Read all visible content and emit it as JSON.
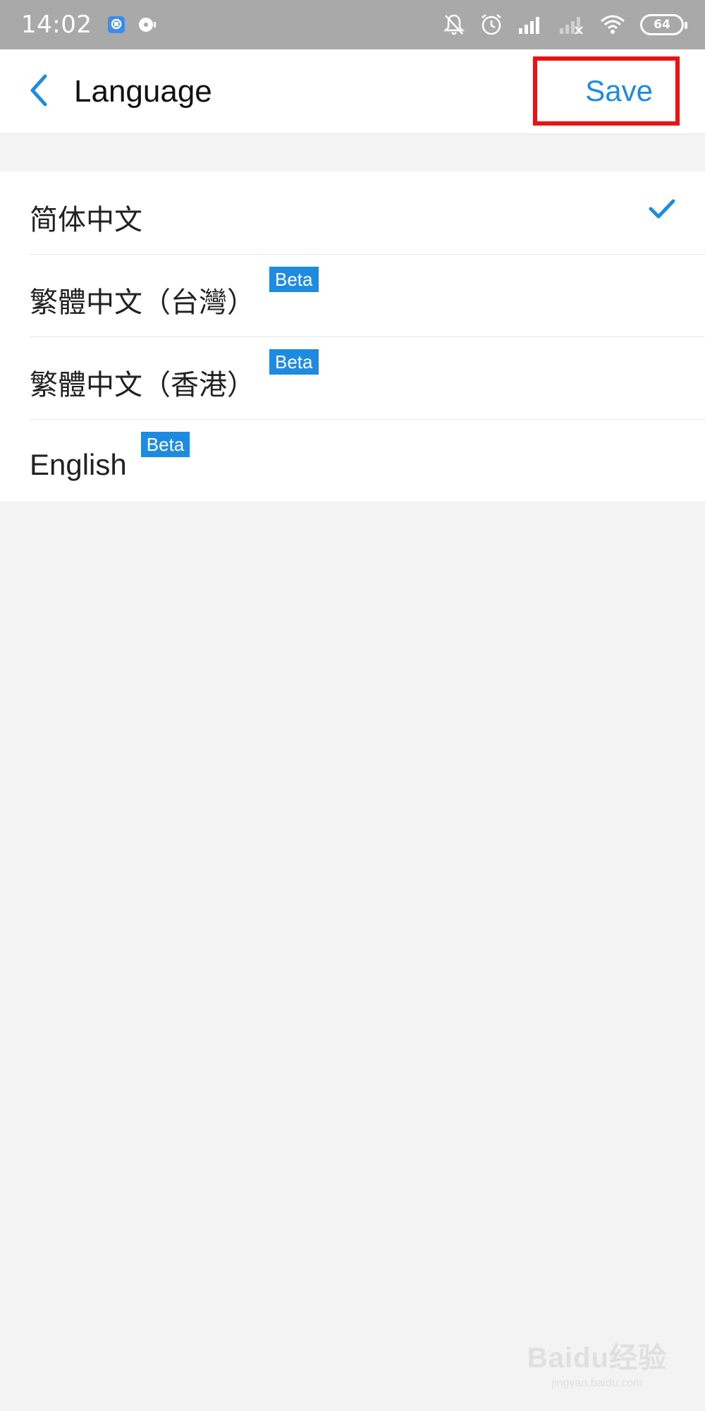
{
  "status_bar": {
    "time": "14:02",
    "battery": "64",
    "icons": [
      "app-notification-icon",
      "music-icon",
      "mute-icon",
      "alarm-icon",
      "signal-icon",
      "signal-weak-icon",
      "wifi-icon",
      "battery-icon"
    ]
  },
  "header": {
    "title": "Language",
    "save_label": "Save"
  },
  "languages": [
    {
      "label": "简体中文",
      "beta": "",
      "selected": true
    },
    {
      "label": "繁體中文（台灣）",
      "beta": "Beta",
      "selected": false
    },
    {
      "label": "繁體中文（香港）",
      "beta": "Beta",
      "selected": false
    },
    {
      "label": "English",
      "beta": "Beta",
      "selected": false
    }
  ],
  "colors": {
    "accent": "#1d8ce0",
    "highlight_box": "#ee1111",
    "background": "#f3f3f3"
  },
  "watermark": {
    "brand": "Baidu经验",
    "url": "jingyan.baidu.com"
  }
}
